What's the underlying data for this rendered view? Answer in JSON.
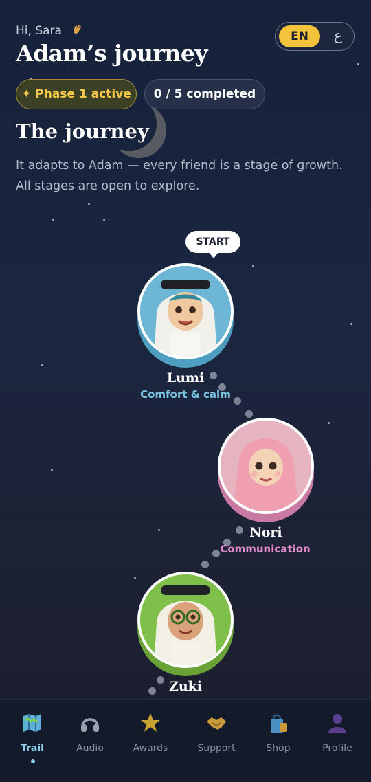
{
  "header": {
    "greeting": "Hi, Sara",
    "greeting_icon": "waving-hand-icon",
    "title": "Adam’s journey",
    "language": {
      "active": "EN",
      "alternate": "ع"
    }
  },
  "badges": {
    "phase": "✦ Phase 1 active",
    "progress": "0 / 5 completed"
  },
  "journey": {
    "heading": "The journey",
    "description": "It adapts to Adam — every friend is a stage of growth. All stages are open to explore."
  },
  "trail": {
    "start_label": "START",
    "stages": [
      {
        "name": "Lumi",
        "subtitle": "Comfort & calm",
        "color": "#4e9ec0",
        "sub_color": "#7cc6e6"
      },
      {
        "name": "Nori",
        "subtitle": "Communication",
        "color": "#c97aa3",
        "sub_color": "#e38ccb"
      },
      {
        "name": "Zuki",
        "subtitle": "",
        "color": "#6aa238",
        "sub_color": "#8fcf5a"
      }
    ]
  },
  "nav": {
    "active": "Trail",
    "items": [
      {
        "label": "Trail",
        "icon": "map-icon"
      },
      {
        "label": "Audio",
        "icon": "headphones-icon"
      },
      {
        "label": "Awards",
        "icon": "star-icon"
      },
      {
        "label": "Support",
        "icon": "handshake-icon"
      },
      {
        "label": "Shop",
        "icon": "shopping-bag-icon"
      },
      {
        "label": "Profile",
        "icon": "person-icon"
      }
    ]
  },
  "colors": {
    "accent": "#f4c33b",
    "active_nav": "#8fd0ef",
    "background": "#16213a"
  }
}
